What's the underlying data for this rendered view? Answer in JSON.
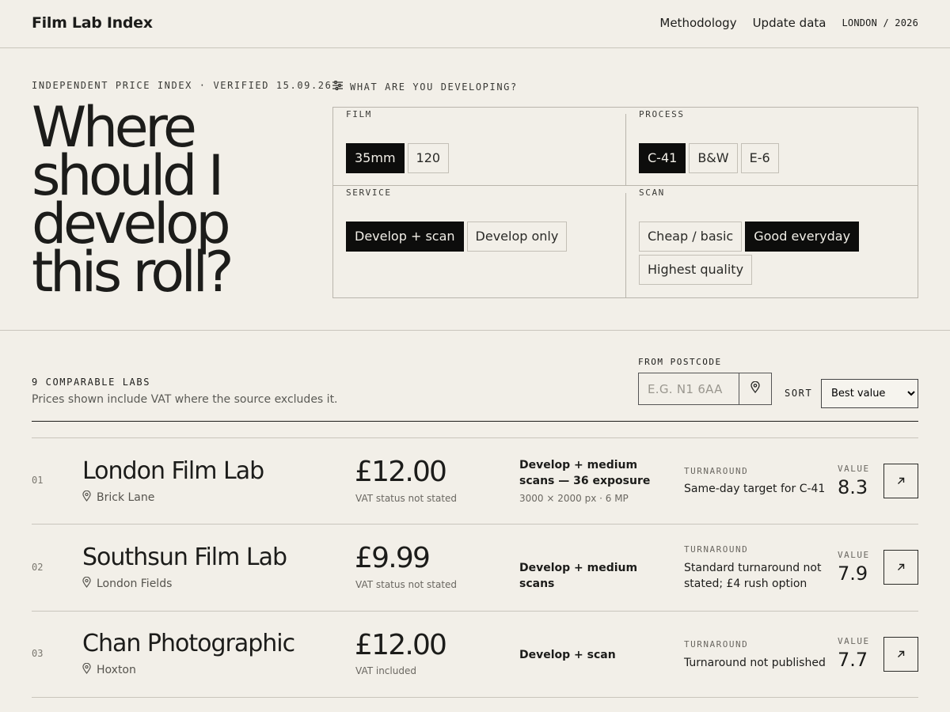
{
  "header": {
    "brand": "Film Lab Index",
    "nav": [
      "Methodology",
      "Update data"
    ],
    "location": "LONDON / 2026"
  },
  "hero": {
    "eyebrow": "INDEPENDENT PRICE INDEX · VERIFIED 15.09.26",
    "headline": "Where should I develop this roll?"
  },
  "picker": {
    "title": "WHAT ARE YOU DEVELOPING?",
    "film": {
      "label": "FILM",
      "options": [
        "35mm",
        "120"
      ],
      "selected": "35mm"
    },
    "process": {
      "label": "PROCESS",
      "options": [
        "C-41",
        "B&W",
        "E-6"
      ],
      "selected": "C-41"
    },
    "service": {
      "label": "SERVICE",
      "options": [
        "Develop + scan",
        "Develop only"
      ],
      "selected": "Develop + scan"
    },
    "scan": {
      "label": "SCAN",
      "options": [
        "Cheap / basic",
        "Good everyday",
        "Highest quality"
      ],
      "selected": "Good everyday"
    }
  },
  "results": {
    "count_label": "9 COMPARABLE LABS",
    "note": "Prices shown include VAT where the source excludes it.",
    "postcode_label": "FROM POSTCODE",
    "postcode_placeholder": "E.G. N1 6AA",
    "postcode_value": "",
    "sort_label": "SORT",
    "sort_selected": "Best value",
    "turnaround_label": "TURNAROUND",
    "value_label": "VALUE",
    "labs": [
      {
        "rank": "01",
        "name": "London Film Lab",
        "area": "Brick Lane",
        "price": "£12.00",
        "vat": "VAT status not stated",
        "service": "Develop + medium scans — 36 exposure",
        "service_detail": "3000 × 2000 px · 6 MP",
        "turnaround": "Same-day target for C-41",
        "value": "8.3"
      },
      {
        "rank": "02",
        "name": "Southsun Film Lab",
        "area": "London Fields",
        "price": "£9.99",
        "vat": "VAT status not stated",
        "service": "Develop + medium scans",
        "service_detail": "",
        "turnaround": "Standard turnaround not stated; £4 rush option",
        "value": "7.9"
      },
      {
        "rank": "03",
        "name": "Chan Photographic",
        "area": "Hoxton",
        "price": "£12.00",
        "vat": "VAT included",
        "service": "Develop + scan",
        "service_detail": "",
        "turnaround": "Turnaround not published",
        "value": "7.7"
      }
    ]
  },
  "icons": {
    "filter": "sliders-icon",
    "pin": "map-pin-icon",
    "arrow": "arrow-up-right-icon"
  }
}
